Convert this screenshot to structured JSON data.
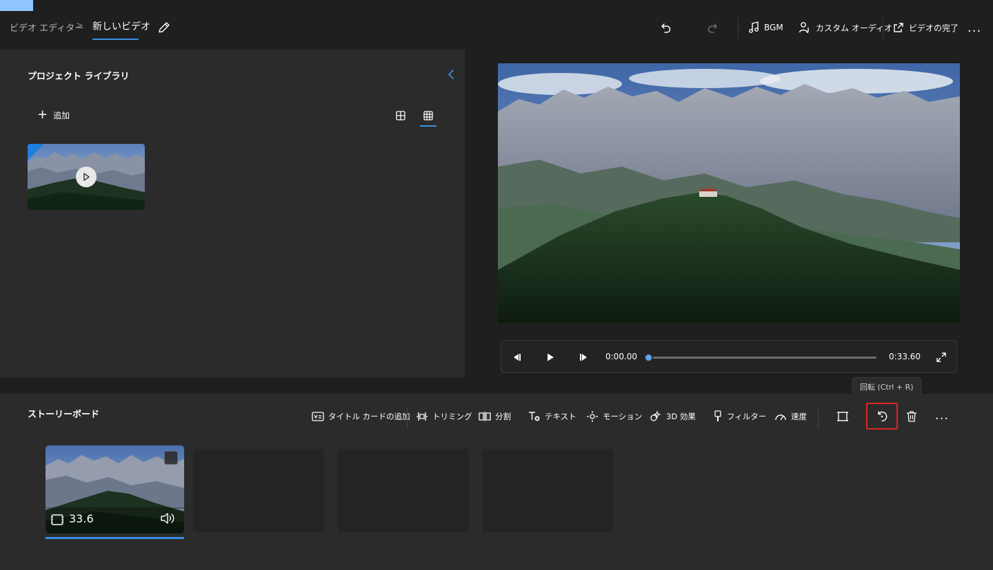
{
  "header": {
    "breadcrumb_root": "ビデオ エディター",
    "breadcrumb_separator": ">",
    "breadcrumb_current": "新しいビデオ",
    "bgm_label": "BGM",
    "custom_audio_label": "カスタム オーディオ",
    "finish_video_label": "ビデオの完了",
    "more_label": "..."
  },
  "library": {
    "title": "プロジェクト ライブラリ",
    "add_label": "追加"
  },
  "player": {
    "current_time": "0:00.00",
    "total_time": "0:33.60",
    "progress_fraction": 0.0
  },
  "storyboard": {
    "title": "ストーリーボード",
    "tools": {
      "title_card": "タイトル カードの追加",
      "trim": "トリミング",
      "split": "分割",
      "text": "テキスト",
      "motion": "モーション",
      "effects_3d": "3D 効果",
      "filters": "フィルター",
      "speed": "速度"
    },
    "more_label": "...",
    "rotate_tooltip": "回転 (Ctrl + R)",
    "clip": {
      "duration": "33.6"
    }
  },
  "colors": {
    "accent": "#3b8fe8",
    "highlight": "#e02424",
    "panel": "#2b2b2b",
    "background": "#1f1f1f"
  }
}
